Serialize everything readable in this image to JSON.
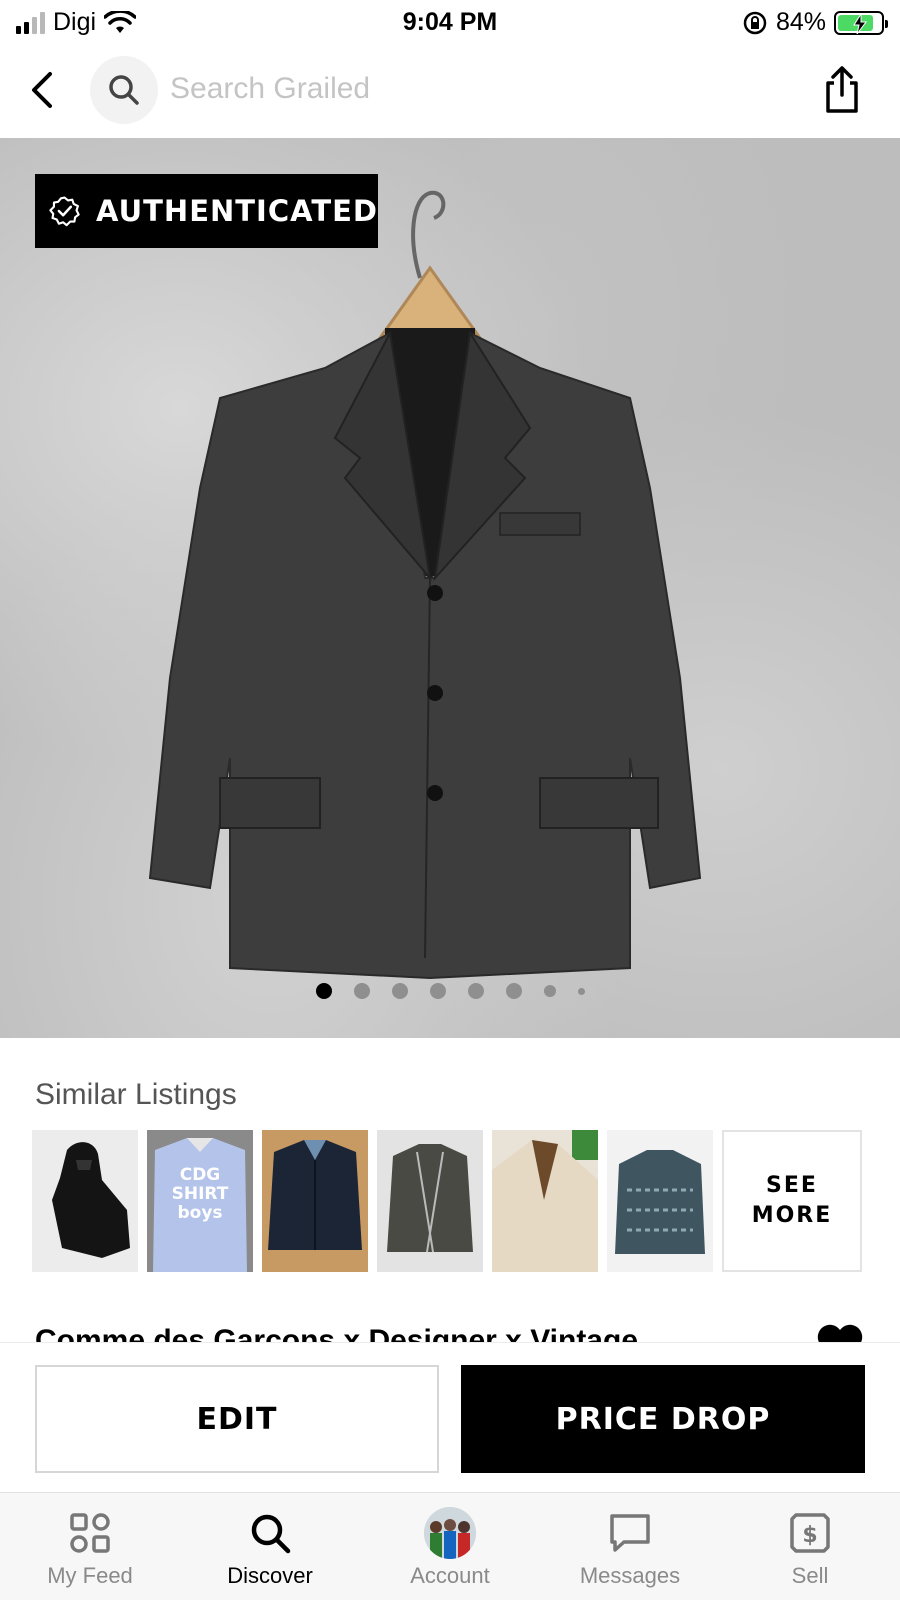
{
  "status_bar": {
    "carrier": "Digi",
    "time": "9:04 PM",
    "battery_percent": "84%",
    "battery_level": 0.84,
    "signal_bars_filled": 2,
    "icons": [
      "cellular-signal-icon",
      "wifi-icon",
      "orientation-lock-icon",
      "battery-charging-icon"
    ]
  },
  "header": {
    "search_placeholder": "Search Grailed",
    "icons": [
      "back-arrow-icon",
      "search-icon",
      "share-icon"
    ]
  },
  "photo": {
    "badge_label": "AUTHENTICATED",
    "badge_icon": "verified-check-icon",
    "total_images": 8,
    "active_image": 1
  },
  "similar_listings": {
    "title": "Similar Listings",
    "see_more_label": "SEE\nMORE",
    "thumb_text": "CDG SHIRT boys"
  },
  "listing": {
    "title": "Comme des Garcons x Designer x Vintage",
    "icon": "heart-icon"
  },
  "actions": {
    "edit_label": "EDIT",
    "price_drop_label": "PRICE DROP"
  },
  "tab_bar": {
    "tabs": [
      {
        "label": "My Feed",
        "icon": "feed-grid-icon"
      },
      {
        "label": "Discover",
        "icon": "search-icon"
      },
      {
        "label": "Account",
        "icon": "avatar-icon"
      },
      {
        "label": "Messages",
        "icon": "chat-bubble-icon"
      },
      {
        "label": "Sell",
        "icon": "sell-dollar-icon"
      }
    ],
    "active": "Discover"
  },
  "colors": {
    "accent": "#000000",
    "battery": "#4cd964",
    "muted_text": "#8a8a8a"
  }
}
